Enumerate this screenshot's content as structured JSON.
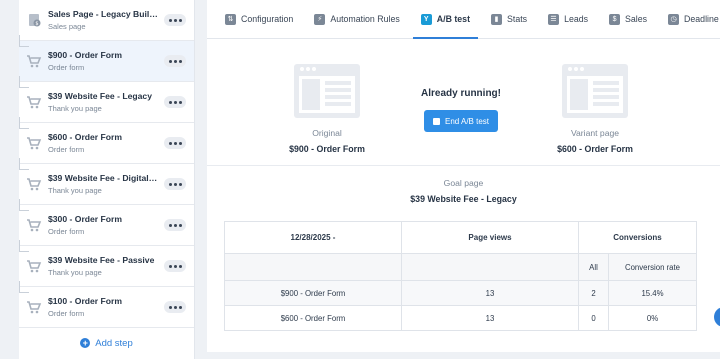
{
  "sidebar": {
    "steps": [
      {
        "title": "Sales Page - Legacy Build...",
        "subtitle": "Sales page",
        "icon": "sales-page-icon"
      },
      {
        "title": "$900 - Order Form",
        "subtitle": "Order form",
        "icon": "cart-icon"
      },
      {
        "title": "$39 Website Fee - Legacy",
        "subtitle": "Thank you page",
        "icon": "cart-icon"
      },
      {
        "title": "$600 - Order Form",
        "subtitle": "Order form",
        "icon": "cart-icon"
      },
      {
        "title": "$39 Website Fee - Digital ...",
        "subtitle": "Thank you page",
        "icon": "cart-icon"
      },
      {
        "title": "$300 - Order Form",
        "subtitle": "Order form",
        "icon": "cart-icon"
      },
      {
        "title": "$39 Website Fee - Passive",
        "subtitle": "Thank you page",
        "icon": "cart-icon"
      },
      {
        "title": "$100 - Order Form",
        "subtitle": "Order form",
        "icon": "cart-icon"
      }
    ],
    "add_step": "Add step"
  },
  "tabs": [
    {
      "label": "Configuration",
      "glyph": "⇅"
    },
    {
      "label": "Automation Rules",
      "glyph": "⚡"
    },
    {
      "label": "A/B test",
      "glyph": "Y"
    },
    {
      "label": "Stats",
      "glyph": "▮"
    },
    {
      "label": "Leads",
      "glyph": "☰"
    },
    {
      "label": "Sales",
      "glyph": "$"
    },
    {
      "label": "Deadline settings",
      "glyph": "◷"
    }
  ],
  "ab_test": {
    "original_label": "Original",
    "original_name": "$900 - Order Form",
    "variant_label": "Variant page",
    "variant_name": "$600 - Order Form",
    "status": "Already running!",
    "end_button": "End A/B test",
    "goal_label": "Goal page",
    "goal_name": "$39 Website Fee - Legacy"
  },
  "table": {
    "date": "12/28/2025 -",
    "page_views": "Page views",
    "conversions": "Conversions",
    "all": "All",
    "conversion_rate": "Conversion rate",
    "rows": [
      {
        "page": "$900 - Order Form",
        "views": "13",
        "all": "2",
        "rate": "15.4%"
      },
      {
        "page": "$600 - Order Form",
        "views": "13",
        "all": "0",
        "rate": "0%"
      }
    ]
  },
  "colors": {
    "accent": "#2f8ee6",
    "active_tab": "#1a9bd6"
  }
}
